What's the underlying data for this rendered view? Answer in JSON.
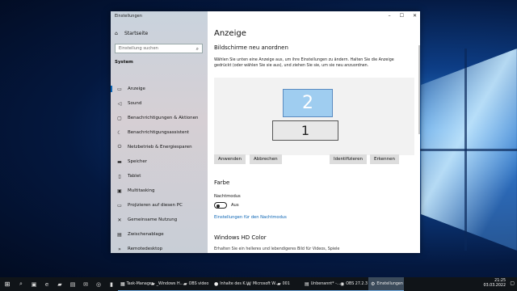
{
  "window": {
    "title": "Einstellungen",
    "controls": {
      "minimize": "–",
      "maximize": "☐",
      "close": "✕"
    }
  },
  "sidebar": {
    "home": "Startseite",
    "search_placeholder": "Einstellung suchen",
    "section": "System",
    "items": [
      {
        "label": "Anzeige",
        "icon": "display-icon",
        "glyph": "▭"
      },
      {
        "label": "Sound",
        "icon": "speaker-icon",
        "glyph": "◁"
      },
      {
        "label": "Benachrichtigungen & Aktionen",
        "icon": "notification-icon",
        "glyph": "▢"
      },
      {
        "label": "Benachrichtigungsassistent",
        "icon": "moon-icon",
        "glyph": "☾"
      },
      {
        "label": "Netzbetrieb & Energiesparen",
        "icon": "power-icon",
        "glyph": "⏻"
      },
      {
        "label": "Speicher",
        "icon": "storage-icon",
        "glyph": "▬"
      },
      {
        "label": "Tablet",
        "icon": "tablet-icon",
        "glyph": "▯"
      },
      {
        "label": "Multitasking",
        "icon": "multitasking-icon",
        "glyph": "▣"
      },
      {
        "label": "Projizieren auf diesen PC",
        "icon": "project-icon",
        "glyph": "▭"
      },
      {
        "label": "Gemeinsame Nutzung",
        "icon": "shared-icon",
        "glyph": "✕"
      },
      {
        "label": "Zwischenablage",
        "icon": "clipboard-icon",
        "glyph": "▤"
      },
      {
        "label": "Remotedesktop",
        "icon": "remote-icon",
        "glyph": "»"
      }
    ]
  },
  "main": {
    "title": "Anzeige",
    "arrange_heading": "Bildschirme neu anordnen",
    "arrange_desc": "Wählen Sie unten eine Anzeige aus, um ihre Einstellungen zu ändern. Halten Sie die Anzeige gedrückt (oder wählen Sie sie aus), und ziehen Sie sie, um sie neu anzuordnen.",
    "monitor_2": "2",
    "monitor_1": "1",
    "buttons": {
      "apply": "Anwenden",
      "cancel": "Abbrechen",
      "identify": "Identifizieren",
      "detect": "Erkennen"
    },
    "color_heading": "Farbe",
    "night_mode_label": "Nachtmodus",
    "night_mode_state": "Aus",
    "night_mode_link": "Einstellungen für den Nachtmodus",
    "hd_heading": "Windows HD Color",
    "hd_desc": "Erhalten Sie ein helleres und lebendigeres Bild für Videos, Spiele"
  },
  "taskbar": {
    "apps": [
      {
        "label": "Task-Manager",
        "icon": "task-manager-icon",
        "glyph": "▦",
        "active": false
      },
      {
        "label": "_Windows H...",
        "icon": "folder-icon",
        "glyph": "▰",
        "active": false
      },
      {
        "label": "OBS video",
        "icon": "folder-icon",
        "glyph": "▰",
        "active": false
      },
      {
        "label": "Inhalte des K...",
        "icon": "firefox-icon",
        "glyph": "●",
        "active": false
      },
      {
        "label": "Microsoft W...",
        "icon": "word-icon",
        "glyph": "W",
        "active": false
      },
      {
        "label": "001",
        "icon": "folder-icon",
        "glyph": "▰",
        "active": false
      },
      {
        "label": "Unbenannt* -...",
        "icon": "paint-icon",
        "glyph": "▤",
        "active": false
      },
      {
        "label": "OBS 27.2.3 (...",
        "icon": "obs-icon",
        "glyph": "◉",
        "active": false
      },
      {
        "label": "Einstellungen",
        "icon": "gear-icon",
        "glyph": "⚙",
        "active": true
      }
    ],
    "time": "21:25",
    "date": "03.03.2022"
  }
}
